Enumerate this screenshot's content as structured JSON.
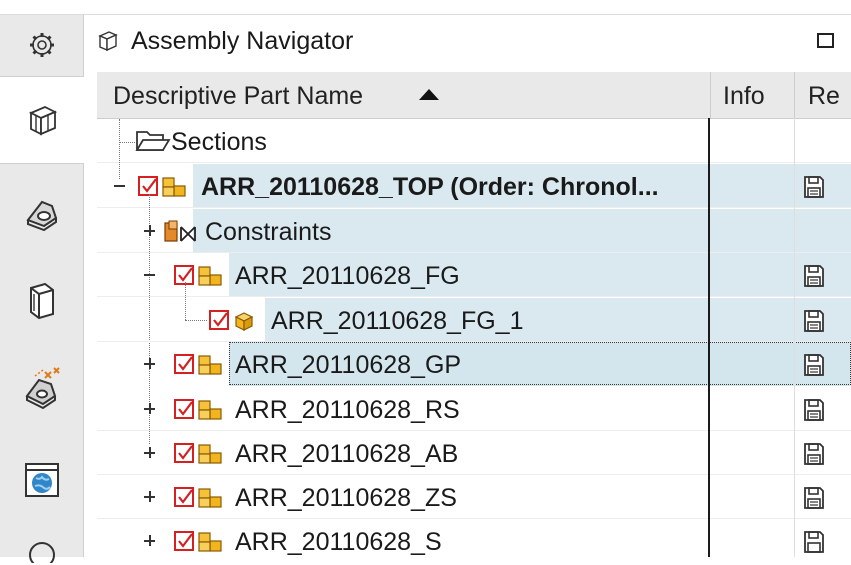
{
  "navigator": {
    "title": "Assembly Navigator",
    "resource_bar": [
      {
        "icon": "gear-icon",
        "active": false
      },
      {
        "icon": "assembly-navigator-icon",
        "active": true
      },
      {
        "icon": "constraint-navigator-icon",
        "active": false
      },
      {
        "icon": "part-navigator-icon",
        "active": false
      },
      {
        "icon": "reuse-library-icon",
        "active": false
      },
      {
        "icon": "web-browser-icon",
        "active": false
      }
    ]
  },
  "columns": {
    "name": "Descriptive Part Name",
    "info": "Info",
    "re": "Re"
  },
  "rows": [
    {
      "label": "Sections",
      "icon": "folder-icon"
    },
    {
      "label": "ARR_20110628_TOP (Order: Chronol...",
      "icon": "assembly-icon",
      "checked": true,
      "expander": "minus"
    },
    {
      "label": "Constraints",
      "icon": "constraints-icon",
      "expander": "plus"
    },
    {
      "label": "ARR_20110628_FG",
      "icon": "assembly-icon",
      "checked": true,
      "expander": "minus"
    },
    {
      "label": "ARR_20110628_FG_1",
      "icon": "component-icon",
      "checked": true
    },
    {
      "label": "ARR_20110628_GP",
      "icon": "assembly-icon",
      "checked": true,
      "expander": "plus"
    },
    {
      "label": "ARR_20110628_RS",
      "icon": "assembly-icon",
      "checked": true,
      "expander": "plus"
    },
    {
      "label": "ARR_20110628_AB",
      "icon": "assembly-icon",
      "checked": true,
      "expander": "plus"
    },
    {
      "label": "ARR_20110628_ZS",
      "icon": "assembly-icon",
      "checked": true,
      "expander": "plus"
    },
    {
      "label": "ARR_20110628_S",
      "icon": "assembly-icon",
      "checked": true,
      "expander": "plus"
    }
  ],
  "colors": {
    "selection": "#d9e9ef",
    "checkbox": "#d42020",
    "assembly": "#f2b51e"
  }
}
